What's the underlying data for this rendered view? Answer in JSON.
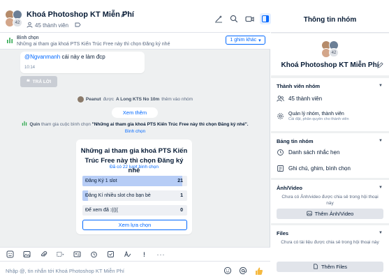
{
  "header": {
    "group_name": "Khoá Photoshop KT Miễn Phí",
    "member_count": "45 thành viên",
    "avatar_badge": "42"
  },
  "pin": {
    "label": "Bình chọn",
    "text": "Những ai tham gia khoá PTS Kiến Trúc Free này thì chọn Đăng ký nhé",
    "button": "1 ghim khác"
  },
  "message": {
    "mention": "@Ngvanmanh",
    "text": " cái này e làm đcp",
    "time": "10:14",
    "reply_label": "TRẢ LỜI"
  },
  "system": {
    "join_name": "Peanut",
    "join_mid": " được ",
    "join_by": "A Long KTS No 10m",
    "join_end": " thêm vào nhóm",
    "see_more": "Xem thêm",
    "poll_user": "Quin",
    "poll_mid": " tham gia cuộc bình chọn ",
    "poll_question": "\"Những ai tham gia khoá PTS Kiến Trúc Free này thì chọn Đăng ký nhé\".",
    "poll_link": "Bình chọn"
  },
  "poll": {
    "question": "Những ai tham gia khoá PTS Kiến Trúc Free này thì chọn Đăng ký nhé",
    "votes": "Đã có 22 lượt bình chọn",
    "options": [
      {
        "label": "Đăng Ký 1 slot",
        "count": "21",
        "fraction": 0.95
      },
      {
        "label": "Đăng Kí nhiều slot cho bạn bè",
        "count": "1",
        "fraction": 0.05
      },
      {
        "label": "Để xem đã :((((",
        "count": "0",
        "fraction": 0
      }
    ],
    "view_button": "Xem lựa chọn"
  },
  "compose": {
    "placeholder": "Nhập @, tin nhắn tới Khoá Photoshop KT Miễn Phí"
  },
  "sidebar": {
    "title": "Thông tin nhóm",
    "group_name": "Khoá Photoshop KT Miễn Phí",
    "avatar_badge": "42",
    "members": {
      "header": "Thành viên nhóm",
      "count": "45 thành viên",
      "manage": "Quản lý nhóm, thành viên",
      "manage_sub": "Cài đặt, phân quyền cho thành viên"
    },
    "board": {
      "header": "Bảng tin nhóm",
      "reminders": "Danh sách nhắc hẹn",
      "notes": "Ghi chú, ghim, bình chọn"
    },
    "media": {
      "header": "Ảnh/Video",
      "desc": "Chưa có Ảnh/video được chia sẻ trong hội thoại này",
      "button": "Thêm Ảnh/Video"
    },
    "files": {
      "header": "Files",
      "desc": "Chưa có tài liệu được chia sẻ trong hội thoại này",
      "button": "Thêm Files"
    }
  },
  "colors": {
    "accent": "#0068ff",
    "poll_fill": "#b7cdf6",
    "background": "#eef0f1"
  }
}
